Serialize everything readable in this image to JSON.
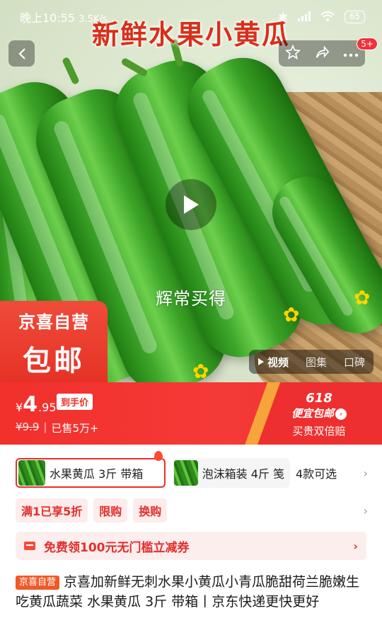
{
  "status_bar": {
    "time": "晚上10:55",
    "speed": "3.5K/s",
    "battery": "65"
  },
  "hero": {
    "title": "新鲜水果小黄瓜",
    "watermark": "辉常买得",
    "notification_count": "5+",
    "badge_line1": "京喜自营",
    "badge_line2": "包邮",
    "media_tabs": [
      "视频",
      "图集",
      "口碑"
    ],
    "active_media_tab": "视频"
  },
  "price": {
    "currency": "¥",
    "integer": "4",
    "decimal": ".95",
    "hand_price_label": "到手价",
    "original": "¥9.9",
    "sold": "已售5万+",
    "promo_number": "618",
    "promo_label": "便宜包邮",
    "promo_sub": "买贵双倍赔"
  },
  "sku": {
    "selected": "水果黄瓜 3斤 带箱",
    "other": "泡沫箱装 4斤 笺",
    "count": "4款可选"
  },
  "promotions": [
    "满1已享5折",
    "限购",
    "换购"
  ],
  "coupon": {
    "text": "免费领100元无门槛立减券"
  },
  "product": {
    "badge": "京喜自营",
    "title": "京喜加新鲜无刺水果小黄瓜小青瓜脆甜荷兰脆嫩生吃黄瓜蔬菜 水果黄瓜 3斤 带箱丨京东快递更快更好"
  },
  "colors": {
    "accent": "#F2302C",
    "promo_orange": "#F7A43B",
    "cucumber_green": "#3EA72A"
  }
}
